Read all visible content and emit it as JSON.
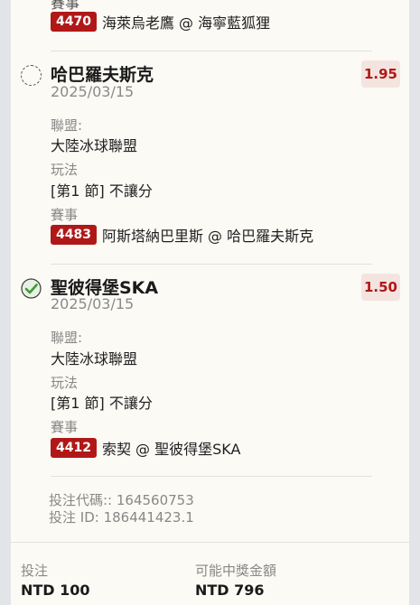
{
  "cut_label": "賽事",
  "legs": [
    {
      "event_id": "4470",
      "event_text": "海萊烏老鷹 @ 海寧藍狐狸"
    },
    {
      "team": "哈巴羅夫斯克",
      "date": "2025/03/15",
      "odds": "1.95",
      "league_label": "聯盟:",
      "league": "大陸冰球聯盟",
      "play_label": "玩法",
      "play": "[第1 節] 不讓分",
      "event_label": "賽事",
      "event_id": "4483",
      "event_text": "阿斯塔納巴里斯 @ 哈巴羅夫斯克",
      "selected": false
    },
    {
      "team": "聖彼得堡SKA",
      "date": "2025/03/15",
      "odds": "1.50",
      "league_label": "聯盟:",
      "league": "大陸冰球聯盟",
      "play_label": "玩法",
      "play": "[第1 節] 不讓分",
      "event_label": "賽事",
      "event_id": "4412",
      "event_text": "索契 @ 聖彼得堡SKA",
      "selected": true
    }
  ],
  "bet_code": "投注代碼:: 164560753",
  "bet_id": "投注 ID: 186441423.1",
  "footer": {
    "stake_label": "投注",
    "stake_value": "NTD 100",
    "payout_label": "可能中獎金額",
    "payout_value": "NTD 796"
  },
  "colors": {
    "accent": "#b01818",
    "check": "#3f9a32"
  }
}
